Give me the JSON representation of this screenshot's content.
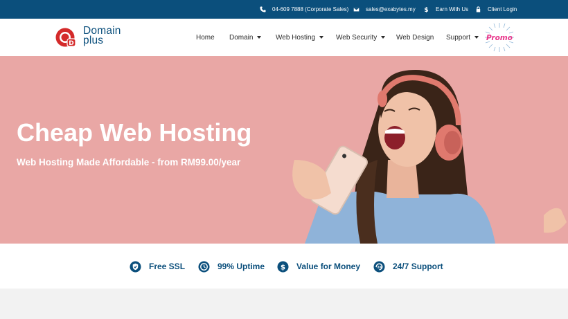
{
  "topbar": {
    "phone": "04-609 7888 (Corporate Sales)",
    "email": "sales@exabytes.my",
    "earn": "Earn With Us",
    "login": "Client Login"
  },
  "brand": {
    "line1": "Domain",
    "line2": "plus",
    "mark_letter": "D"
  },
  "nav": {
    "home": "Home",
    "domain": "Domain",
    "web_hosting": "Web Hosting",
    "web_security": "Web Security",
    "web_design": "Web Design",
    "support": "Support"
  },
  "promo": {
    "label": "Promo"
  },
  "hero": {
    "title": "Cheap Web Hosting",
    "subtitle": "Web Hosting Made Affordable - from RM99.00/year"
  },
  "features": {
    "ssl": "Free SSL",
    "uptime": "99% Uptime",
    "value": "Value for Money",
    "support": "24/7 Support"
  },
  "colors": {
    "topbar": "#0b4f7c",
    "brand_blue": "#0b4f7c",
    "brand_red": "#d42a2a",
    "hero_bg": "#e9a7a5",
    "promo_pink": "#e8358a"
  }
}
